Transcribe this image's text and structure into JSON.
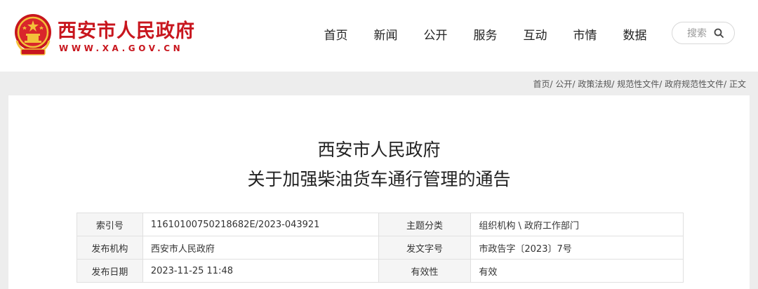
{
  "header": {
    "site_name": "西安市人民政府",
    "site_url": "WWW.XA.GOV.CN",
    "nav": [
      {
        "label": "首页"
      },
      {
        "label": "新闻"
      },
      {
        "label": "公开"
      },
      {
        "label": "服务"
      },
      {
        "label": "互动"
      },
      {
        "label": "市情"
      },
      {
        "label": "数据"
      }
    ],
    "search": {
      "placeholder": "搜索",
      "icon": "search-icon"
    }
  },
  "breadcrumb": {
    "items": [
      "首页",
      "公开",
      "政策法规",
      "规范性文件",
      "政府规范性文件",
      "正文"
    ],
    "separator": "/"
  },
  "article": {
    "title_line1": "西安市人民政府",
    "title_line2": "关于加强柴油货车通行管理的通告"
  },
  "info_table": {
    "rows": [
      {
        "k1": "索引号",
        "v1": "11610100750218682E/2023-043921",
        "k2": "主题分类",
        "v2": "组织机构 \\ 政府工作部门"
      },
      {
        "k1": "发布机构",
        "v1": "西安市人民政府",
        "k2": "发文字号",
        "v2": "市政告字〔2023〕7号"
      },
      {
        "k1": "发布日期",
        "v1": "2023-11-25 11:48",
        "k2": "有效性",
        "v2": "有效"
      }
    ]
  },
  "colors": {
    "brand_red": "#c8161e",
    "page_bg": "#ededed"
  }
}
